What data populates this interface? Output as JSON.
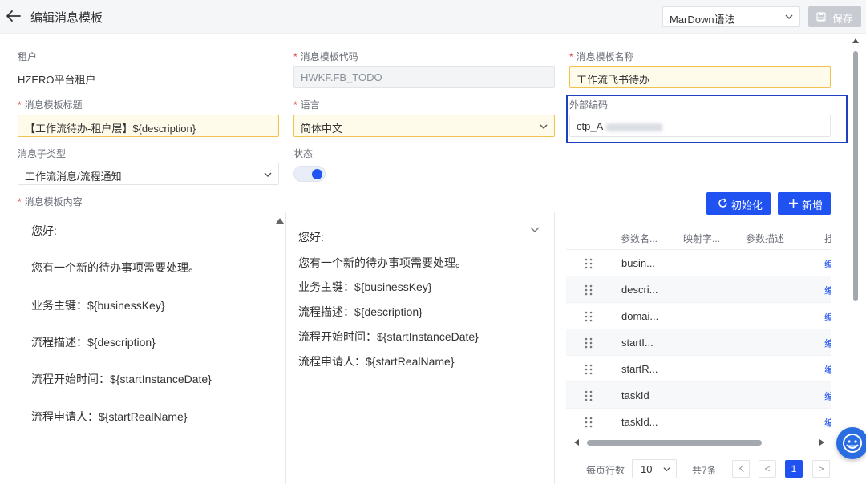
{
  "header": {
    "title": "编辑消息模板",
    "syntax_select": "MarDown语法",
    "save_label": "保存"
  },
  "form": {
    "tenant_label": "租户",
    "tenant_value": "HZERO平台租户",
    "code_label": "消息模板代码",
    "code_value": "HWKF.FB_TODO",
    "name_label": "消息模板名称",
    "name_value": "工作流飞书待办",
    "title_label": "消息模板标题",
    "title_value": "【工作流待办-租户层】${description}",
    "language_label": "语言",
    "language_value": "简体中文",
    "external_code_label": "外部编码",
    "external_code_value": "ctp_A",
    "subtype_label": "消息子类型",
    "subtype_value": "工作流消息/流程通知",
    "status_label": "状态",
    "status_on": true,
    "content_label": "消息模板内容",
    "required_mark": "*"
  },
  "editor": {
    "lines": [
      "您好:",
      "您有一个新的待办事项需要处理。",
      "业务主键：${businessKey}",
      "流程描述：${description}",
      "流程开始时间：${startInstanceDate}",
      "流程申请人：${startRealName}"
    ]
  },
  "preview": {
    "lines": [
      "您好:",
      "您有一个新的待办事项需要处理。",
      "业务主键：${businessKey}",
      "流程描述：${description}",
      "流程开始时间：${startInstanceDate}",
      "流程申请人：${startRealName}"
    ]
  },
  "params": {
    "init_label": "初始化",
    "add_label": "新增",
    "columns": [
      "参数名...",
      "映射字...",
      "参数描述",
      "挂"
    ],
    "rows": [
      "busin...",
      "descri...",
      "domai...",
      "startI...",
      "startR...",
      "taskId",
      "taskId..."
    ],
    "edit_label": "编"
  },
  "pagination": {
    "per_page_label": "每页行数",
    "per_page_value": "10",
    "total_label": "共7条",
    "first_label": "K",
    "prev_label": "<",
    "current_page": "1",
    "next_label": ">"
  },
  "colors": {
    "primary": "#1f52f0",
    "required": "#e0443a",
    "highlight_border": "#1e3fbf"
  }
}
